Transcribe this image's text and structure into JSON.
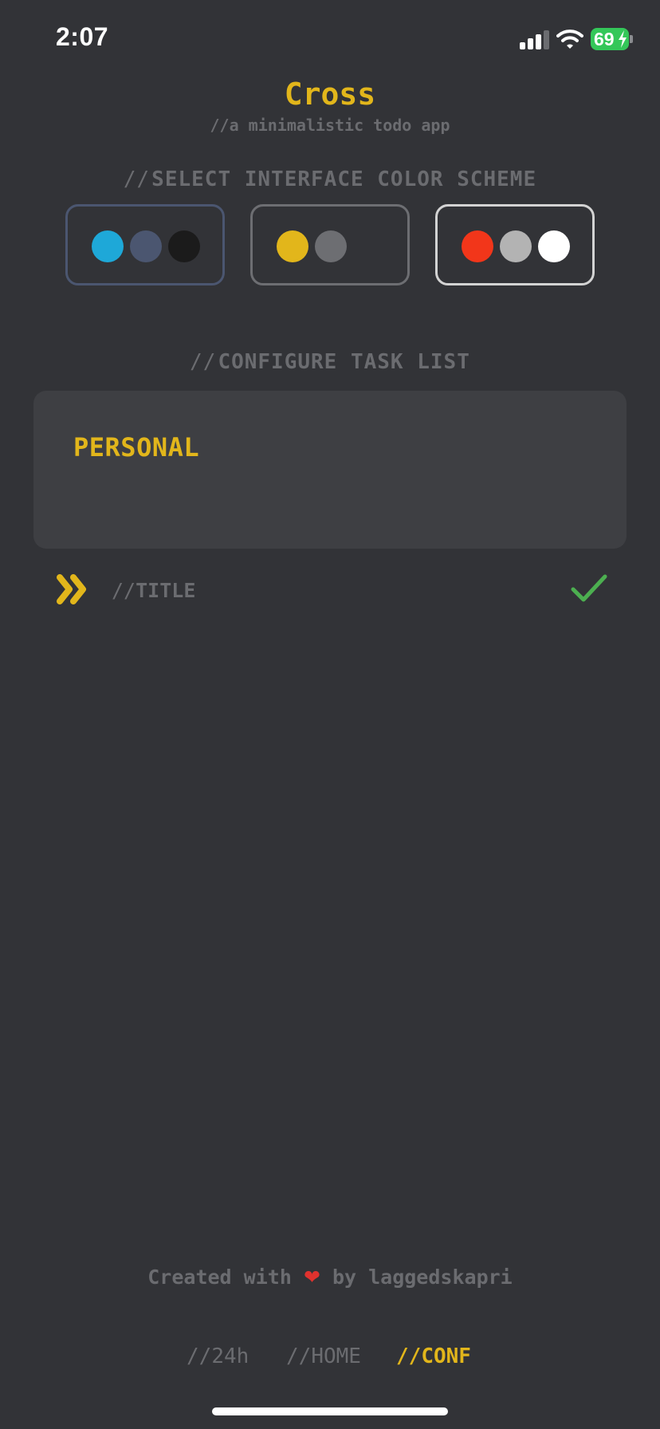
{
  "status_bar": {
    "time": "2:07",
    "battery": "69",
    "icons": [
      "cellular-signal-icon",
      "wifi-icon",
      "battery-charging-icon"
    ]
  },
  "header": {
    "title": "Cross",
    "subtitle": "//a minimalistic todo app"
  },
  "color_scheme": {
    "slashes": "//",
    "label": "SELECT INTERFACE COLOR SCHEME",
    "options": [
      {
        "colors": [
          "#1ea8d8",
          "#4b5670",
          "#1b1b1b"
        ],
        "border": "#4b5670",
        "selected": false
      },
      {
        "colors": [
          "#e2b61b",
          "#6d6e72"
        ],
        "border": "#6d6e72",
        "selected": false
      },
      {
        "colors": [
          "#f2361a",
          "#b3b3b3",
          "#ffffff"
        ],
        "border": "#d3d3d3",
        "selected": true
      }
    ]
  },
  "task_list": {
    "slashes": "//",
    "label": "CONFIGURE TASK LIST",
    "name": "PERSONAL",
    "field_slashes": "//",
    "field_label": "TITLE"
  },
  "footer": {
    "credit_prefix": "Created with",
    "heart": "❤",
    "credit_suffix": "by laggedskapri"
  },
  "bottom_nav": [
    {
      "slashes": "//",
      "label": "24h",
      "active": false
    },
    {
      "slashes": "//",
      "label": "HOME",
      "active": false
    },
    {
      "slashes": "//",
      "label": "CONF",
      "active": true
    }
  ],
  "colors": {
    "background": "#323337",
    "accent": "#e2b61b",
    "muted_text": "#6b6c70",
    "card": "#3e3f43",
    "confirm_check": "#4caf50"
  }
}
